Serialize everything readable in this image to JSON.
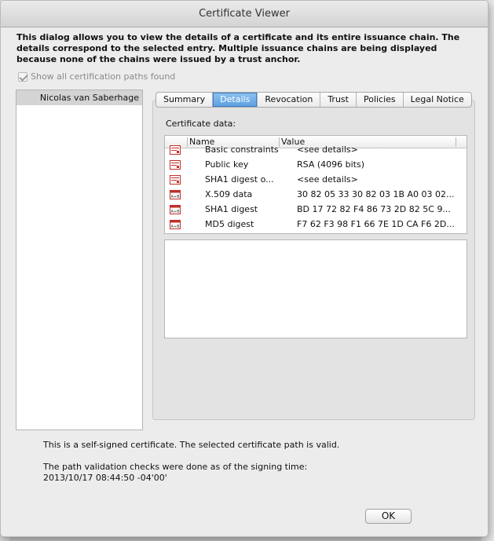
{
  "window": {
    "title": "Certificate Viewer"
  },
  "intro": "This dialog allows you to view the details of a certificate and its entire issuance chain. The details correspond to the selected entry. Multiple issuance chains are being displayed because none of the chains were issued by a trust anchor.",
  "show_all": {
    "label": "Show all certification paths found",
    "checked": true,
    "enabled": false
  },
  "paths": [
    "Nicolas van Saberhage"
  ],
  "tabs": [
    {
      "label": "Summary",
      "active": false
    },
    {
      "label": "Details",
      "active": true
    },
    {
      "label": "Revocation",
      "active": false
    },
    {
      "label": "Trust",
      "active": false
    },
    {
      "label": "Policies",
      "active": false
    },
    {
      "label": "Legal Notice",
      "active": false
    }
  ],
  "details": {
    "label": "Certificate data:",
    "columns": {
      "name": "Name",
      "value": "Value"
    },
    "rows": [
      {
        "icon": "certificate-icon",
        "name": "Basic constraints",
        "value": "<see details>"
      },
      {
        "icon": "certificate-icon",
        "name": "Public key",
        "value": "RSA (4096 bits)"
      },
      {
        "icon": "certificate-icon",
        "name": "SHA1 digest o...",
        "value": "<see details>"
      },
      {
        "icon": "binary-data-icon",
        "name": "X.509 data",
        "value": "30 82 05 33 30 82 03 1B A0 03 02..."
      },
      {
        "icon": "binary-data-icon",
        "name": "SHA1 digest",
        "value": "BD 17 72 82 F4 86 73 2D 82 5C 9..."
      },
      {
        "icon": "binary-data-icon",
        "name": "MD5 digest",
        "value": "F7 62 F3 98 F1 66 7E 1D CA F6 2D..."
      }
    ]
  },
  "status": "This is a self-signed certificate. The selected certificate path is valid.",
  "validation": {
    "line1": "The path validation checks were done as of the signing time:",
    "line2": "2013/10/17 08:44:50 -04'00'"
  },
  "buttons": {
    "ok": "OK"
  },
  "colors": {
    "accent": "#5a9fe0",
    "icon_red": "#c0302a"
  }
}
